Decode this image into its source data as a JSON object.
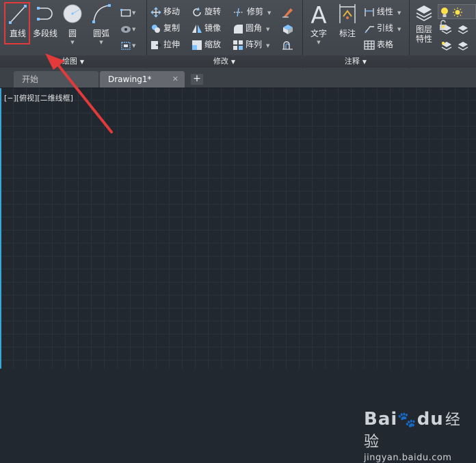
{
  "ribbon": {
    "draw_panel": {
      "title": "绘图",
      "line_label": "直线",
      "polyline_label": "多段线",
      "circle_label": "圆",
      "arc_label": "圆弧"
    },
    "modify_panel": {
      "title": "修改",
      "move": "移动",
      "rotate": "旋转",
      "trim": "修剪",
      "copy": "复制",
      "mirror": "镜像",
      "fillet": "圆角",
      "stretch": "拉伸",
      "scale": "缩放",
      "array": "阵列"
    },
    "annotation_panel": {
      "title": "注释",
      "text_label": "文字",
      "dimension_label": "标注",
      "linear": "线性",
      "leader": "引线",
      "table": "表格"
    },
    "layers_panel": {
      "layer_props_label": "图层\n特性"
    }
  },
  "tabs": {
    "start": "开始",
    "drawing": "Drawing1*",
    "close_glyph": "✕",
    "add_glyph": "+"
  },
  "viewport": {
    "view_label": "[−][俯视][二维线框]"
  },
  "watermark": {
    "logo": "Bai",
    "logo_tail": "du",
    "jingyan": "经验",
    "url": "jingyan.baidu.com"
  },
  "colors": {
    "accent_highlight": "#e23a3a",
    "annotation_arrow": "#e23a3a",
    "viewport_bg": "#212830",
    "ribbon_bg": "#43474e"
  },
  "icons": [
    "line-icon",
    "polyline-icon",
    "circle-icon",
    "arc-icon",
    "move-icon",
    "rotate-icon",
    "trim-icon",
    "copy-icon",
    "mirror-icon",
    "fillet-icon",
    "stretch-icon",
    "scale-icon",
    "array-icon",
    "text-icon",
    "dimension-icon",
    "linear-icon",
    "leader-icon",
    "table-icon",
    "layer-properties-icon",
    "lightbulb-icon",
    "sun-icon"
  ]
}
